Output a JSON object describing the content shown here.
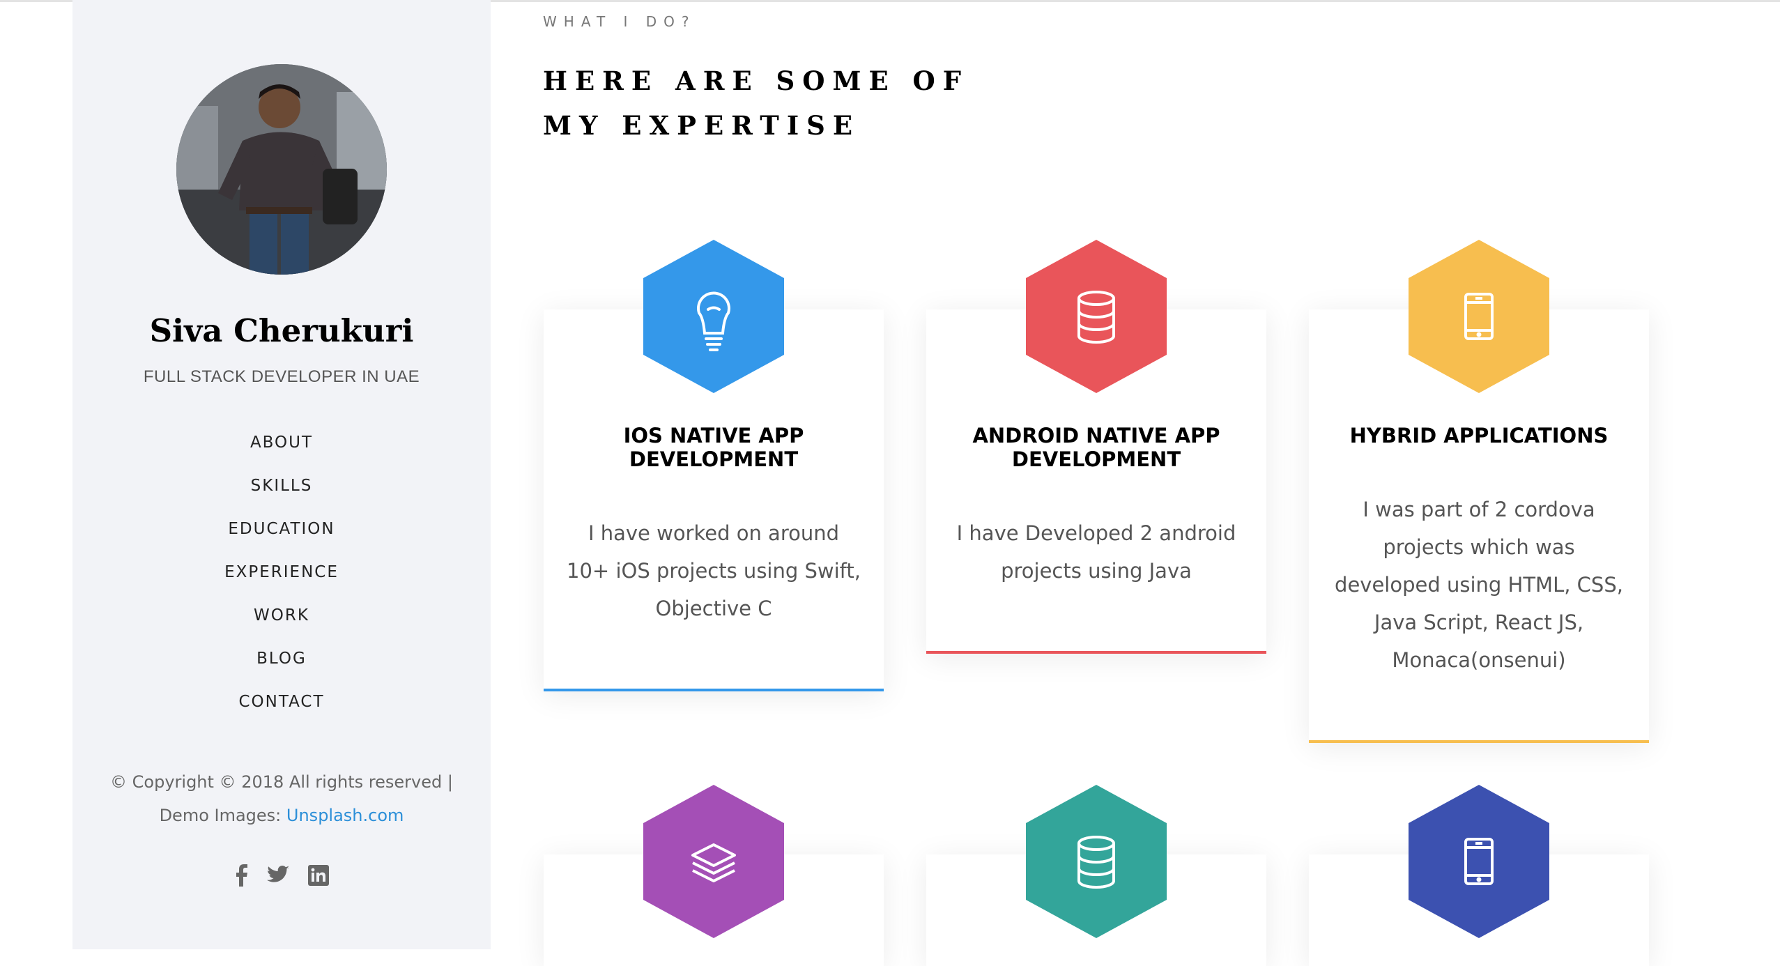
{
  "sidebar": {
    "name": "Siva Cherukuri",
    "role": "FULL STACK DEVELOPER IN UAE",
    "menu": [
      "ABOUT",
      "SKILLS",
      "EDUCATION",
      "EXPERIENCE",
      "WORK",
      "BLOG",
      "CONTACT"
    ],
    "copyright_line1": "© Copyright © 2018 All rights reserved |",
    "copyright_prefix": "Demo Images: ",
    "copyright_link": "Unsplash.com",
    "social_icons": [
      "facebook-icon",
      "twitter-icon",
      "linkedin-icon"
    ]
  },
  "main": {
    "eyebrow": "WHAT I DO?",
    "heading": "HERE ARE SOME OF MY EXPERTISE",
    "services": [
      {
        "title": "IOS NATIVE APP DEVELOPMENT",
        "desc": "I have worked on around 10+ iOS projects using Swift, Objective C",
        "color": "#3498ea",
        "icon": "lightbulb-icon"
      },
      {
        "title": "ANDROID NATIVE APP DEVELOPMENT",
        "desc": "I have Developed 2 android projects using Java",
        "color": "#e9555a",
        "icon": "database-icon"
      },
      {
        "title": "HYBRID APPLICATIONS",
        "desc": "I was part of 2 cordova projects which was developed using HTML, CSS, Java Script, React JS, Monaca(onsenui)",
        "color": "#f7be4f",
        "icon": "mobile-icon"
      },
      {
        "title": "",
        "desc": "",
        "color": "#a44fb6",
        "icon": "layers-icon"
      },
      {
        "title": "",
        "desc": "",
        "color": "#33a59a",
        "icon": "database-icon"
      },
      {
        "title": "",
        "desc": "",
        "color": "#3c51b0",
        "icon": "mobile-icon"
      }
    ]
  }
}
